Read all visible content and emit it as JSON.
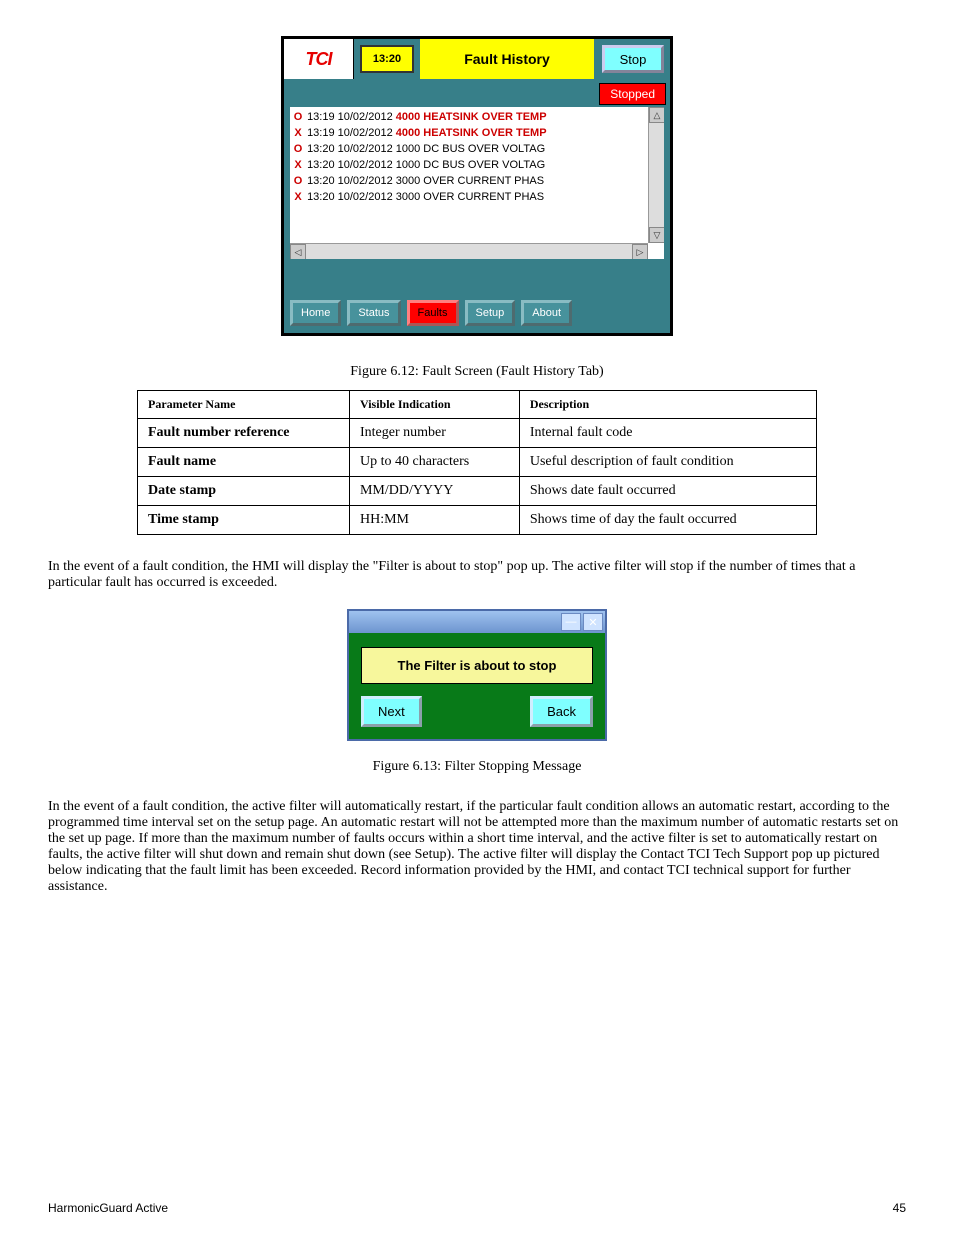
{
  "hmi1": {
    "logo": "TCI",
    "time": "13:20",
    "title": "Fault History",
    "stop": "Stop",
    "status": "Stopped",
    "rows": [
      {
        "mark": "O",
        "ts": "13:19 10/02/2012",
        "msg": "4000 HEATSINK OVER TEMP",
        "red": true
      },
      {
        "mark": "X",
        "ts": "13:19 10/02/2012",
        "msg": "4000 HEATSINK OVER TEMP",
        "red": true
      },
      {
        "mark": "O",
        "ts": "13:20 10/02/2012",
        "msg": "1000 DC BUS OVER VOLTAG",
        "red": false
      },
      {
        "mark": "X",
        "ts": "13:20 10/02/2012",
        "msg": "1000 DC BUS OVER VOLTAG",
        "red": false
      },
      {
        "mark": "O",
        "ts": "13:20 10/02/2012",
        "msg": "3000 OVER CURRENT PHAS",
        "red": false
      },
      {
        "mark": "X",
        "ts": "13:20 10/02/2012",
        "msg": "3000 OVER CURRENT PHAS",
        "red": false
      }
    ],
    "nav": [
      "Home",
      "Status",
      "Faults",
      "Setup",
      "About"
    ],
    "nav_active": 2
  },
  "fig1": "Figure 6.12:   Fault Screen (Fault History Tab)",
  "table": {
    "headers": [
      "Parameter Name",
      "Visible Indication",
      "Description"
    ],
    "rows": [
      [
        "Fault number reference",
        "Integer number",
        "Internal fault code"
      ],
      [
        "Fault name",
        "Up to 40 characters",
        "Useful description of fault condition"
      ],
      [
        "Date stamp",
        "MM/DD/YYYY",
        "Shows date fault occurred"
      ],
      [
        "Time stamp",
        "HH:MM",
        "Shows time of day the fault occurred"
      ]
    ]
  },
  "para1": "In the event of a fault condition, the HMI will display the \"Filter is about to stop\" pop up. The active filter will stop if the number of times that a particular fault has occurred is exceeded.",
  "hmi2": {
    "msg": "The Filter is about to stop",
    "next": "Next",
    "back": "Back"
  },
  "fig2": "Figure 6.13:   Filter Stopping Message",
  "para2": "In the event of a fault condition, the active filter will automatically restart, if the particular fault condition allows an automatic restart, according to the programmed time interval set on the setup page. An automatic restart will not be attempted more than the maximum number of automatic restarts set on the set up page. If more than the maximum number of faults occurs within a short time interval, and the active filter is set to automatically restart on faults, the active filter will shut down and remain shut down (see Setup). The active filter will display the Contact TCI Tech Support pop up pictured below indicating that the fault limit has been exceeded. Record information provided by the HMI, and contact TCI technical support for further assistance.",
  "footer": {
    "left": "HarmonicGuard Active",
    "right": "45"
  }
}
